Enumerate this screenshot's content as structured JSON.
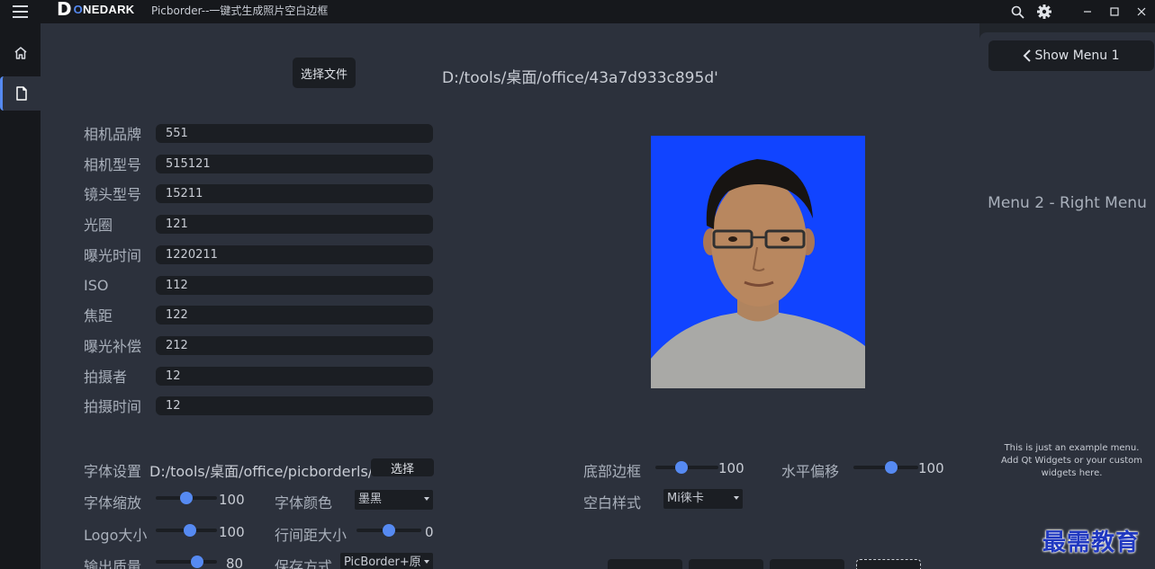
{
  "titlebar": {
    "logo_mark": "D",
    "logo_word_prefix": "O",
    "logo_word_rest": "NEDARK",
    "app_title": "Picborder--一键式生成照片空白边框",
    "icons": [
      "search-icon",
      "gear-icon",
      "minimize-icon",
      "maximize-icon",
      "close-icon"
    ]
  },
  "rail": {
    "items": [
      {
        "icon": "home-icon",
        "active": false
      },
      {
        "icon": "file-icon",
        "active": true
      }
    ]
  },
  "file": {
    "button_label": "选择文件",
    "path": "D:/tools/桌面/office/43a7d933c895d'"
  },
  "exif_fields": [
    {
      "label": "相机品牌",
      "value": "551"
    },
    {
      "label": "相机型号",
      "value": "515121"
    },
    {
      "label": "镜头型号",
      "value": "15211"
    },
    {
      "label": "光圈",
      "value": "121"
    },
    {
      "label": "曝光时间",
      "value": "1220211"
    },
    {
      "label": "ISO",
      "value": "112"
    },
    {
      "label": "焦距",
      "value": "122"
    },
    {
      "label": "曝光补偿",
      "value": "212"
    },
    {
      "label": "拍摄者",
      "value": "12"
    },
    {
      "label": "拍摄时间",
      "value": "12"
    }
  ],
  "font_settings": {
    "label": "字体设置",
    "path": "D:/tools/桌面/office/picborderls/",
    "button_label": "选择"
  },
  "font_scale": {
    "label": "字体缩放",
    "value": "100",
    "level": 0.5
  },
  "font_color": {
    "label": "字体颜色",
    "selected": "墨黑"
  },
  "logo_size": {
    "label": "Logo大小",
    "value": "100",
    "level": 0.58
  },
  "line_spacing": {
    "label": "行间距大小",
    "value": "0",
    "level": 0.5
  },
  "output_quality": {
    "label": "输出质量",
    "value": "80",
    "level": 0.72
  },
  "save_mode": {
    "label": "保存方式",
    "selected": "PicBorder+原"
  },
  "bottom_border": {
    "label": "底部边框",
    "value": "100",
    "level": 0.4
  },
  "horizontal_offset": {
    "label": "水平偏移",
    "value": "100",
    "level": 0.6
  },
  "blank_style": {
    "label": "空白样式",
    "selected": "Mi徕卡"
  },
  "right_menu": {
    "show_menu_label": "Show Menu 1",
    "title": "Menu 2 - Right Menu",
    "note_line1": "This is just an example menu.",
    "note_line2": "Add Qt Widgets or your custom",
    "note_line3": "widgets here."
  },
  "watermark": "最需教育",
  "colors": {
    "accent": "#568af2",
    "background": "#2c313c",
    "dark": "#1b1e23",
    "photo_background": "#1144ff"
  }
}
